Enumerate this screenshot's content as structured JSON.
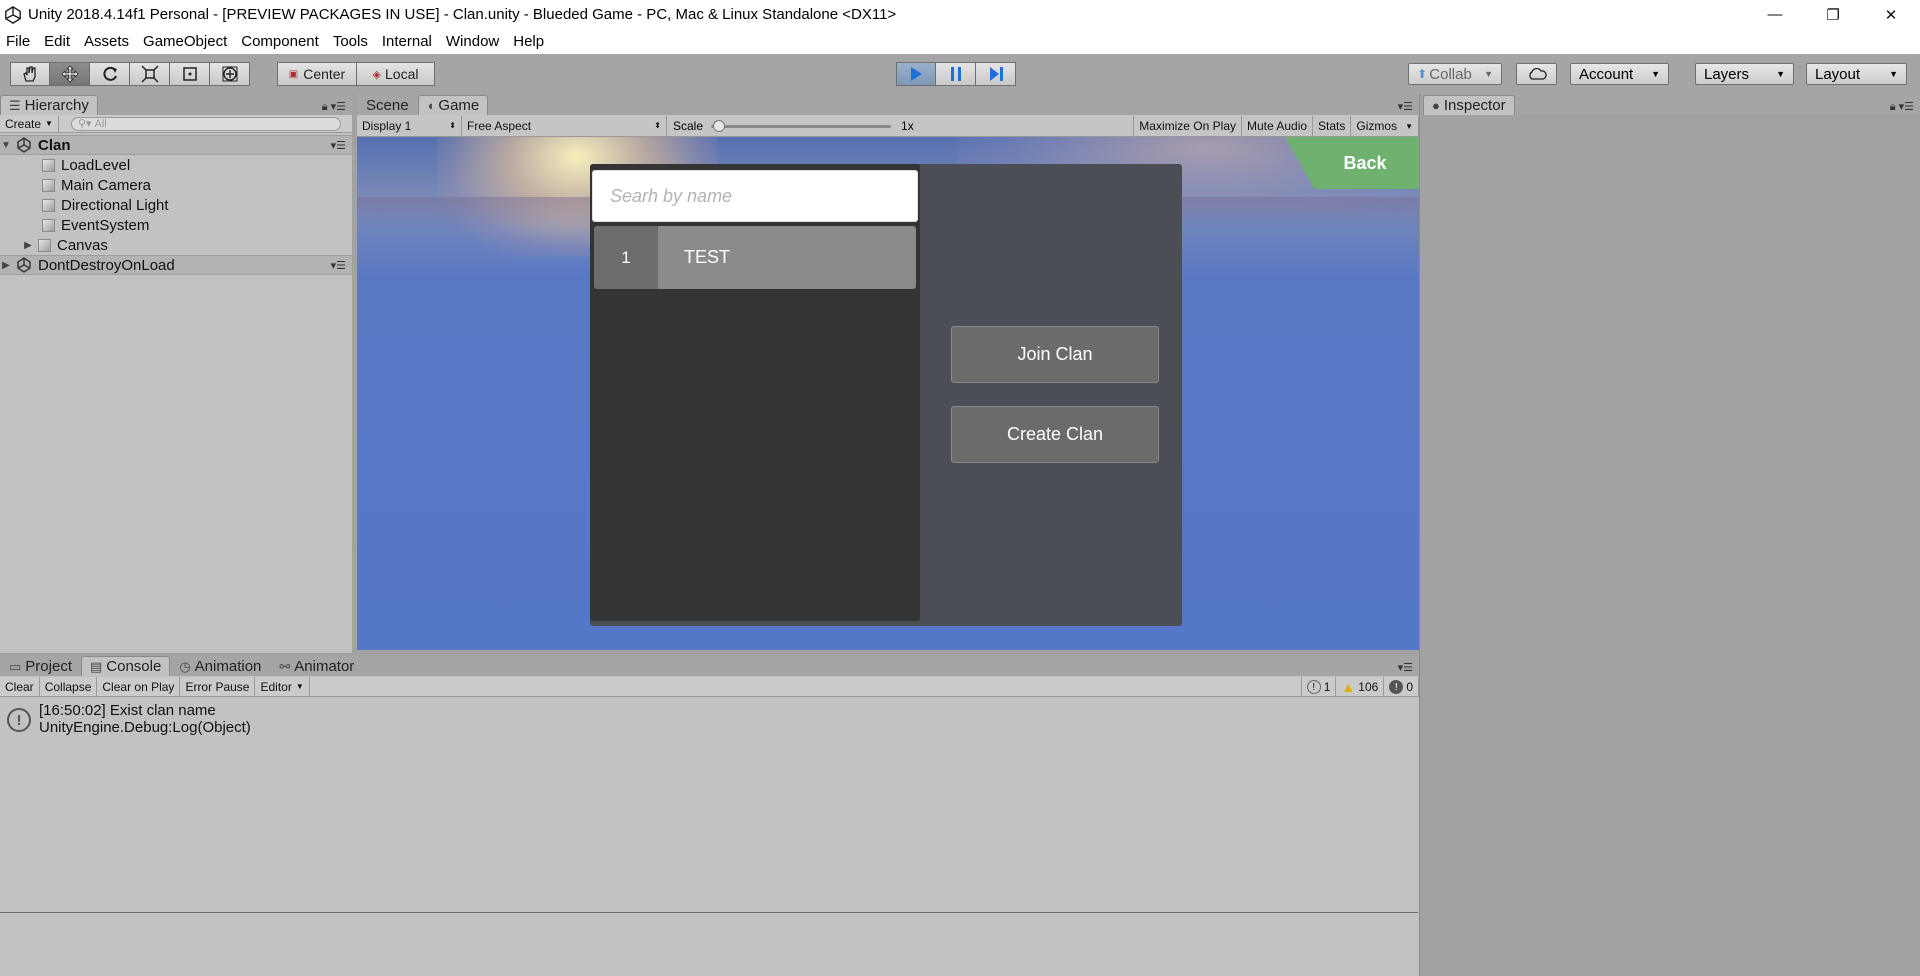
{
  "window": {
    "title": "Unity 2018.4.14f1 Personal - [PREVIEW PACKAGES IN USE] - Clan.unity - Blueded Game - PC, Mac & Linux Standalone <DX11>",
    "minimize": "—",
    "maximize": "❐",
    "close": "✕"
  },
  "menu": [
    "File",
    "Edit",
    "Assets",
    "GameObject",
    "Component",
    "Tools",
    "Internal",
    "Window",
    "Help"
  ],
  "toolbar": {
    "center_label": "Center",
    "local_label": "Local",
    "collab_label": "Collab",
    "account_label": "Account",
    "layers_label": "Layers",
    "layout_label": "Layout",
    "tools": [
      "hand-icon",
      "move-icon",
      "rotate-icon",
      "scale-icon",
      "rect-icon",
      "transform-icon"
    ],
    "play_states": {
      "playing": true
    }
  },
  "hierarchy": {
    "tab_label": "Hierarchy",
    "create_label": "Create",
    "search_placeholder": "All",
    "scene_name": "Clan",
    "objects": [
      "LoadLevel",
      "Main Camera",
      "Directional Light",
      "EventSystem",
      "Canvas"
    ],
    "dont_destroy": "DontDestroyOnLoad"
  },
  "game_tabs": {
    "scene_label": "Scene",
    "game_label": "Game"
  },
  "game_toolbar": {
    "display": "Display 1",
    "aspect": "Free Aspect",
    "scale_label": "Scale",
    "scale_value": "1x",
    "maximize": "Maximize On Play",
    "mute": "Mute Audio",
    "stats": "Stats",
    "gizmos": "Gizmos"
  },
  "game_ui": {
    "search_placeholder": "Searh by name",
    "clan_rank": "1",
    "clan_name": "TEST",
    "join_label": "Join Clan",
    "create_label": "Create Clan",
    "back_label": "Back"
  },
  "inspector": {
    "tab_label": "Inspector"
  },
  "bottom_tabs": {
    "project": "Project",
    "console": "Console",
    "animation": "Animation",
    "animator": "Animator"
  },
  "console": {
    "clear": "Clear",
    "collapse": "Collapse",
    "clear_on_play": "Clear on Play",
    "error_pause": "Error Pause",
    "editor": "Editor",
    "info_count": "1",
    "warning_count": "106",
    "error_count": "0",
    "message_line1": "[16:50:02] Exist clan name",
    "message_line2": "UnityEngine.Debug:Log(Object)"
  }
}
